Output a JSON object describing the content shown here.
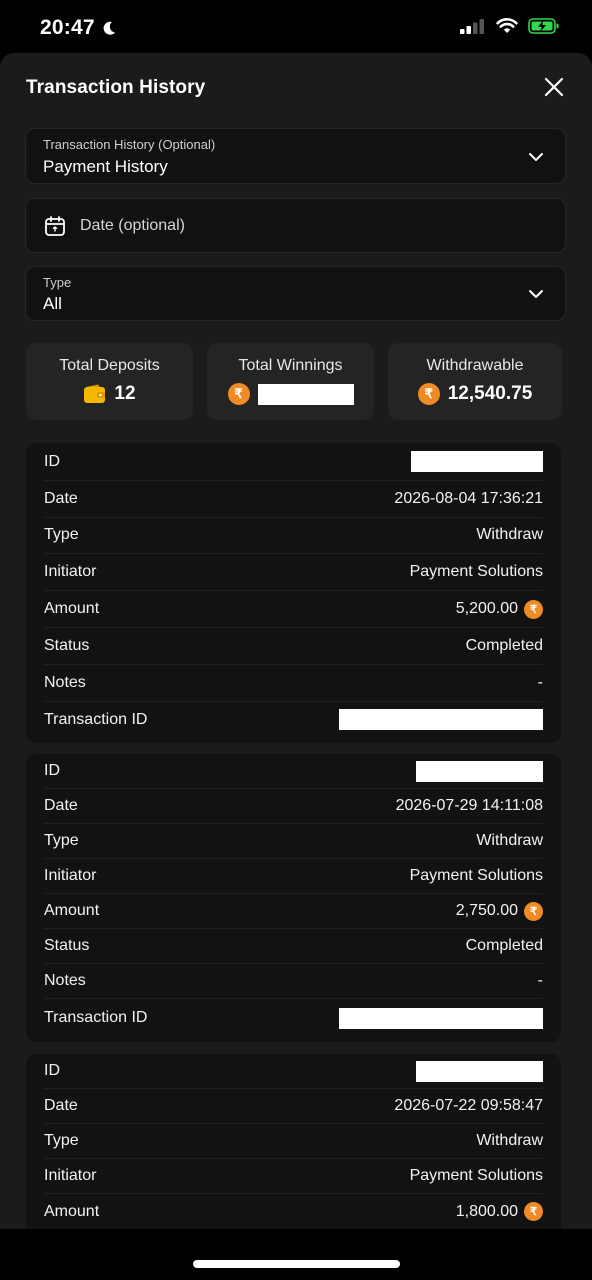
{
  "status_bar": {
    "time": "20:47"
  },
  "sheet": {
    "title": "Transaction History"
  },
  "filters": {
    "history_select": {
      "label": "Transaction History (Optional)",
      "value": "Payment History"
    },
    "date": {
      "placeholder": "Date (optional)"
    },
    "type_select": {
      "label": "Type",
      "value": "All"
    }
  },
  "stats": {
    "deposits": {
      "label": "Total Deposits",
      "value": "12"
    },
    "winnings": {
      "label": "Total Winnings",
      "value": ""
    },
    "withdrawable": {
      "label": "Withdrawable",
      "value": "12,540.75"
    }
  },
  "currency_symbol": "₹",
  "row_labels": {
    "id": "ID",
    "date": "Date",
    "type": "Type",
    "initiator": "Initiator",
    "amount": "Amount",
    "status": "Status",
    "notes": "Notes",
    "transaction_id": "Transaction ID"
  },
  "transactions": [
    {
      "date": "2026-08-04 17:36:21",
      "type": "Withdraw",
      "initiator": "Payment Solutions",
      "amount": "5,200.00",
      "status": "Completed",
      "notes": "-"
    },
    {
      "date": "2026-07-29 14:11:08",
      "type": "Withdraw",
      "initiator": "Payment Solutions",
      "amount": "2,750.00",
      "status": "Completed",
      "notes": "-"
    },
    {
      "date": "2026-07-22 09:58:47",
      "type": "Withdraw",
      "initiator": "Payment Solutions",
      "amount": "1,800.00"
    }
  ],
  "colors": {
    "accent_coin": "#f08a24",
    "background": "#1b1b1b",
    "card": "#121212",
    "wallet": "#f5b800"
  }
}
